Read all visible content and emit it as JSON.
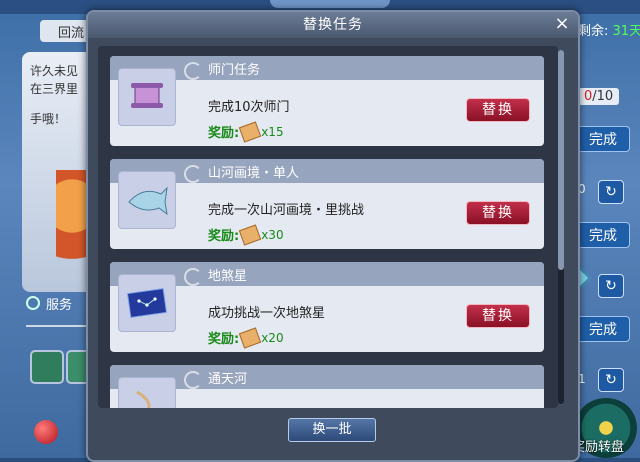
{
  "background": {
    "tab_label": "回流",
    "speech_lines": [
      "许久未见",
      "在三界里",
      "手哦！"
    ],
    "service_label": "服务",
    "remaining_label": "剩余:",
    "remaining_value": "31天",
    "count_current": "0",
    "count_total": "/10",
    "complete_label": "完成",
    "num_1": "0",
    "num_2": "1",
    "wheel_label": "奖励转盘"
  },
  "dialog": {
    "title": "替换任务",
    "close_glyph": "×",
    "batch_button": "换一批",
    "tasks": [
      {
        "title": "师门任务",
        "desc": "完成10次师门",
        "reward_label": "奖励:",
        "reward_amount": "x15",
        "button": "替换",
        "icon": "purple-scroll-icon"
      },
      {
        "title": "山河画境・单人",
        "desc": "完成一次山河画境・里挑战",
        "reward_label": "奖励:",
        "reward_amount": "x30",
        "button": "替换",
        "icon": "silver-fish-icon"
      },
      {
        "title": "地煞星",
        "desc": "成功挑战一次地煞星",
        "reward_label": "奖励:",
        "reward_amount": "x20",
        "button": "替换",
        "icon": "star-map-icon"
      },
      {
        "title": "通天河",
        "desc": "",
        "reward_label": "",
        "reward_amount": "",
        "button": "",
        "icon": "bow-icon"
      }
    ]
  }
}
